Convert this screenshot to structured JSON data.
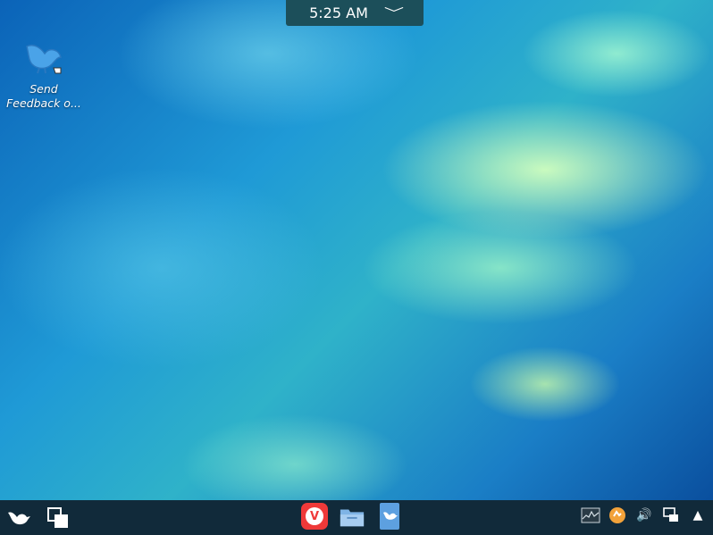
{
  "clock": {
    "time": "5:25 AM",
    "chevron": "﹀"
  },
  "desktop_icons": [
    {
      "label_line1": "Send",
      "label_line2": "Feedback o...",
      "icon": "feedback-bird-icon"
    }
  ],
  "taskbar": {
    "left": [
      {
        "icon": "launcher-bird-icon"
      },
      {
        "icon": "window-switcher-icon"
      }
    ],
    "apps": [
      {
        "icon": "vivaldi-browser-icon",
        "glyph": "V"
      },
      {
        "icon": "file-manager-icon"
      },
      {
        "icon": "feedback-app-icon"
      }
    ],
    "tray": [
      {
        "icon": "system-monitor-icon"
      },
      {
        "icon": "update-manager-icon"
      },
      {
        "icon": "volume-icon",
        "glyph": "🔊"
      },
      {
        "icon": "network-icon"
      },
      {
        "icon": "tray-expand-icon",
        "glyph": "▲"
      }
    ]
  },
  "colors": {
    "taskbar": "#112a3a",
    "clock_bg": "#1c4f5a",
    "vivaldi": "#ef3939"
  }
}
